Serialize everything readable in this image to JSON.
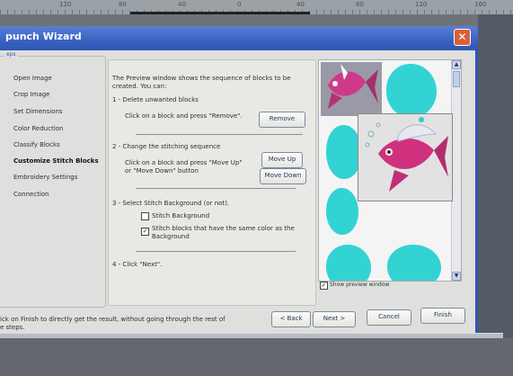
{
  "ruler": {
    "labels": [
      "120",
      "80",
      "40",
      "0",
      "40",
      "80",
      "120",
      "160"
    ]
  },
  "window": {
    "title": "punch Wizard",
    "close_glyph": "✕"
  },
  "steps": {
    "legend": "eps",
    "items": [
      {
        "label": "Open Image",
        "active": false
      },
      {
        "label": "Crop Image",
        "active": false
      },
      {
        "label": "Set Dimensions",
        "active": false
      },
      {
        "label": "Color Reduction",
        "active": false
      },
      {
        "label": "Classify Blocks",
        "active": false
      },
      {
        "label": "Customize Stitch Blocks",
        "active": true
      },
      {
        "label": "Embroidery Settings",
        "active": false
      },
      {
        "label": "Connection",
        "active": false
      }
    ]
  },
  "content": {
    "intro_1": "The Preview window shows the sequence of blocks to be",
    "intro_2": "created. You can:",
    "step1_title": "1 - Delete unwanted blocks",
    "step1_text": "Click on a block and press \"Remove\".",
    "remove_label": "Remove",
    "step2_title": "2 - Change the stitching sequence",
    "step2_text_1": "Click on a block and press \"Move Up\"",
    "step2_text_2": "or \"Move Down\" button",
    "move_up_label": "Move Up",
    "move_down_label": "Move Down",
    "step3_title": "3 - Select Stitch Background (or not).",
    "stitch_bg_label": "Stitch Background",
    "stitch_blocks_label_1": "Stitch blocks that have the same color as the",
    "stitch_blocks_label_2": "Background",
    "stitch_blocks_checked": "✓",
    "step4_title": "4 - Click \"Next\"."
  },
  "preview": {
    "show_label": "Show preview window",
    "checked": "✓",
    "colors": {
      "cyan": "#33d3d3",
      "fish_pink": "#d0317f",
      "fish_dark": "#7a2a6a"
    }
  },
  "footer": {
    "note_1": "ick on Finish to directly get the result, without going through the rest of",
    "note_2": "e steps.",
    "back_label": "< Back",
    "next_label": "Next >",
    "cancel_label": "Cancel",
    "finish_label": "Finish"
  }
}
